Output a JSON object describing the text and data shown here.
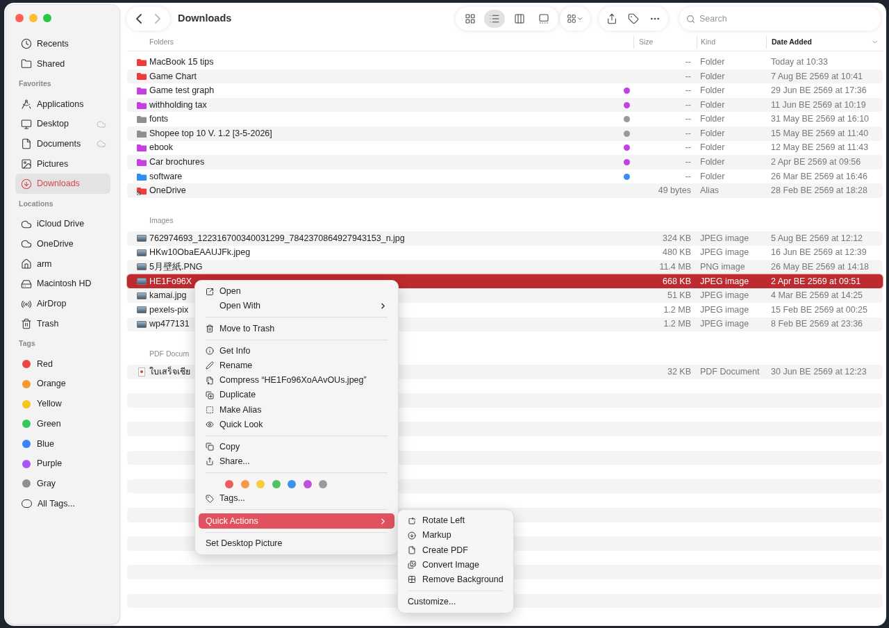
{
  "window": {
    "title": "Downloads"
  },
  "toolbar": {
    "views": [
      {
        "selected": false
      },
      {
        "selected": true
      },
      {
        "selected": false
      },
      {
        "selected": false
      }
    ],
    "search": {
      "placeholder": "Search"
    }
  },
  "sidebar": {
    "sections": [
      {
        "items": [
          {
            "label": "Recents",
            "selected": false
          },
          {
            "label": "Shared",
            "selected": false
          }
        ]
      },
      {
        "label": "Favorites",
        "items": [
          {
            "label": "Applications",
            "selected": false,
            "cloud": false
          },
          {
            "label": "Desktop",
            "selected": false,
            "cloud": true
          },
          {
            "label": "Documents",
            "selected": false,
            "cloud": true
          },
          {
            "label": "Pictures",
            "selected": false,
            "cloud": false
          },
          {
            "label": "Downloads",
            "selected": true,
            "cloud": false
          }
        ]
      },
      {
        "label": "Locations",
        "items": [
          {
            "label": "iCloud Drive",
            "selected": false
          },
          {
            "label": "OneDrive",
            "selected": false
          },
          {
            "label": "arm",
            "selected": false
          },
          {
            "label": "Macintosh HD",
            "selected": false
          },
          {
            "label": "AirDrop",
            "selected": false
          },
          {
            "label": "Trash",
            "selected": false
          }
        ]
      },
      {
        "label": "Tags",
        "items": [
          {
            "label": "Red",
            "kind": "tag",
            "color": "#ef4444",
            "selected": false
          },
          {
            "label": "Orange",
            "kind": "tag",
            "color": "#f59a2f",
            "selected": false
          },
          {
            "label": "Yellow",
            "kind": "tag",
            "color": "#f5c518",
            "selected": false
          },
          {
            "label": "Green",
            "kind": "tag",
            "color": "#34c759",
            "selected": false
          },
          {
            "label": "Blue",
            "kind": "tag",
            "color": "#3b82f6",
            "selected": false
          },
          {
            "label": "Purple",
            "kind": "tag",
            "color": "#a855f7",
            "selected": false
          },
          {
            "label": "Gray",
            "kind": "tag",
            "color": "#8e8e93",
            "selected": false
          },
          {
            "label": "All Tags...",
            "kind": "all",
            "selected": false
          }
        ]
      }
    ]
  },
  "table": {
    "columns": [
      {
        "label": "Size",
        "sorted": false
      },
      {
        "label": "Kind",
        "sorted": false
      },
      {
        "label": "Date Added",
        "sorted": true
      }
    ],
    "sections": [
      {
        "label": "Folders",
        "rows": [
          {
            "name": "MacBook 15 tips",
            "kind": "folder",
            "color": "#ef3b3b",
            "size": "--",
            "file_kind": "Folder",
            "date": "Today at 10:33",
            "selected": false
          },
          {
            "name": "Game Chart",
            "kind": "folder",
            "color": "#ef3b3b",
            "size": "--",
            "file_kind": "Folder",
            "date": "7 Aug BE 2569 at 10:41",
            "selected": false
          },
          {
            "name": "Game test graph",
            "kind": "folder",
            "color": "#c640e0",
            "tag": {
              "color": "#c640e0"
            },
            "size": "--",
            "file_kind": "Folder",
            "date": "29 Jun BE 2569 at 17:36",
            "selected": false
          },
          {
            "name": "withholding tax",
            "kind": "folder",
            "color": "#c640e0",
            "tag": {
              "color": "#c640e0"
            },
            "size": "--",
            "file_kind": "Folder",
            "date": "11 Jun BE 2569 at 10:19",
            "selected": false
          },
          {
            "name": "fonts",
            "kind": "folder",
            "color": "#8e8e93",
            "tag": {
              "color": "#9a9a9e"
            },
            "size": "--",
            "file_kind": "Folder",
            "date": "31 May BE 2569 at 16:10",
            "selected": false
          },
          {
            "name": "Shopee top 10 V. 1.2 [3-5-2026]",
            "kind": "folder",
            "color": "#8e8e93",
            "tag": {
              "color": "#9a9a9e"
            },
            "size": "--",
            "file_kind": "Folder",
            "date": "15 May BE 2569 at 11:40",
            "selected": false
          },
          {
            "name": "ebook",
            "kind": "folder",
            "color": "#c640e0",
            "tag": {
              "color": "#c640e0"
            },
            "size": "--",
            "file_kind": "Folder",
            "date": "12 May BE 2569 at 11:43",
            "selected": false
          },
          {
            "name": "Car brochures",
            "kind": "folder",
            "color": "#c640e0",
            "tag": {
              "color": "#c640e0"
            },
            "size": "--",
            "file_kind": "Folder",
            "date": "2 Apr BE 2569 at 09:56",
            "selected": false
          },
          {
            "name": "software",
            "kind": "folder",
            "color": "#2f8ef0",
            "tag": {
              "color": "#3a8ff0"
            },
            "size": "--",
            "file_kind": "Folder",
            "date": "26 Mar BE 2569 at 16:46",
            "selected": false
          },
          {
            "name": "OneDrive",
            "kind": "alias",
            "color": "#ef3b3b",
            "size": "49 bytes",
            "file_kind": "Alias",
            "date": "28 Feb BE 2569 at 18:28",
            "selected": false
          }
        ]
      },
      {
        "label": "Images",
        "rows": [
          {
            "name": "762974693_122316700340031299_7842370864927943153_n.jpg",
            "kind": "image",
            "size": "324 KB",
            "file_kind": "JPEG image",
            "date": "5 Aug BE 2569 at 12:12",
            "selected": false
          },
          {
            "name": "HKw10ObaEAAUJFk.jpeg",
            "kind": "image",
            "size": "480 KB",
            "file_kind": "JPEG image",
            "date": "16 Jun BE 2569 at 12:39",
            "selected": false
          },
          {
            "name": "5月壁紙.PNG",
            "kind": "image",
            "size": "11.4 MB",
            "file_kind": "PNG image",
            "date": "26 May BE 2569 at 14:18",
            "selected": false
          },
          {
            "name": "HE1Fo96X",
            "kind": "image",
            "size": "668 KB",
            "file_kind": "JPEG image",
            "date": "2 Apr BE 2569 at 09:51",
            "selected": true
          },
          {
            "name": "kamai.jpg",
            "kind": "image",
            "size": "51 KB",
            "file_kind": "JPEG image",
            "date": "4 Mar BE 2569 at 14:25",
            "selected": false
          },
          {
            "name": "pexels-pix",
            "kind": "image",
            "size": "1.2 MB",
            "file_kind": "JPEG image",
            "date": "15 Feb BE 2569 at 00:25",
            "selected": false
          },
          {
            "name": "wp477131",
            "kind": "image",
            "size": "1.2 MB",
            "file_kind": "JPEG image",
            "date": "8 Feb BE 2569 at 23:36",
            "selected": false
          }
        ]
      },
      {
        "label": "PDF Docum",
        "rows": [
          {
            "name": "ใบเสร็จเชีย",
            "kind": "pdf",
            "size": "32 KB",
            "file_kind": "PDF Document",
            "date": "30 Jun BE 2569 at 12:23",
            "selected": false
          }
        ]
      }
    ]
  },
  "context_menu": {
    "groups": [
      {
        "items": [
          {
            "kind": "item",
            "label": "Open",
            "submenu": false,
            "selected": false
          },
          {
            "kind": "item",
            "label": "Open With",
            "submenu": true,
            "selected": false
          }
        ]
      },
      {
        "items": [
          {
            "kind": "item",
            "label": "Move to Trash",
            "submenu": false,
            "selected": false
          }
        ]
      },
      {
        "items": [
          {
            "kind": "item",
            "label": "Get Info",
            "submenu": false,
            "selected": false
          },
          {
            "kind": "item",
            "label": "Rename",
            "submenu": false,
            "selected": false
          },
          {
            "kind": "item",
            "label": "Compress “HE1Fo96XoAAvOUs.jpeg”",
            "submenu": false,
            "selected": false
          },
          {
            "kind": "item",
            "label": "Duplicate",
            "submenu": false,
            "selected": false
          },
          {
            "kind": "item",
            "label": "Make Alias",
            "submenu": false,
            "selected": false
          },
          {
            "kind": "item",
            "label": "Quick Look",
            "submenu": false,
            "selected": false
          }
        ]
      },
      {
        "items": [
          {
            "kind": "item",
            "label": "Copy",
            "submenu": false,
            "selected": false
          },
          {
            "kind": "item",
            "label": "Share...",
            "submenu": false,
            "selected": false
          }
        ]
      },
      {
        "items": [
          {
            "kind": "colors",
            "colors": [
              {
                "color": "#ef5b5f"
              },
              {
                "color": "#f59a45"
              },
              {
                "color": "#f7cd3c"
              },
              {
                "color": "#4cc465"
              },
              {
                "color": "#3d8ff0"
              },
              {
                "color": "#c04fe0"
              },
              {
                "color": "#9a9a9e"
              }
            ]
          },
          {
            "kind": "item",
            "label": "Tags...",
            "submenu": false,
            "selected": false
          }
        ]
      },
      {
        "items": [
          {
            "kind": "item",
            "label": "Quick Actions",
            "submenu": true,
            "selected": true
          }
        ]
      },
      {
        "items": [
          {
            "kind": "item",
            "label": "Set Desktop Picture",
            "submenu": false,
            "selected": false
          }
        ]
      }
    ]
  },
  "submenu": {
    "items": [
      {
        "kind": "item",
        "label": "Rotate Left"
      },
      {
        "kind": "item",
        "label": "Markup"
      },
      {
        "kind": "item",
        "label": "Create PDF"
      },
      {
        "kind": "item",
        "label": "Convert Image"
      },
      {
        "kind": "item",
        "label": "Remove Background"
      },
      {
        "kind": "separator"
      },
      {
        "kind": "item",
        "label": "Customize..."
      }
    ]
  }
}
